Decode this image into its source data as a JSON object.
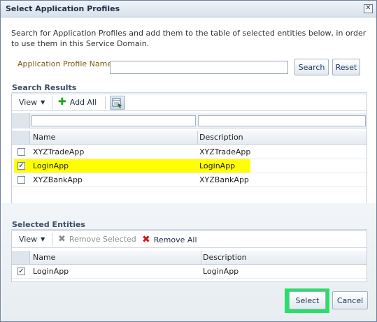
{
  "dialog": {
    "title": "Select Application Profiles",
    "close_glyph": "✕",
    "instructions": "Search for Application Profiles and add them to the table of selected entities below, in order to use them in this Service Domain.",
    "name_label": "Application Profile Name",
    "name_value": "",
    "search_label": "Search",
    "reset_label": "Reset"
  },
  "search_results": {
    "title": "Search Results",
    "toolbar": {
      "view_label": "View",
      "add_all_label": "Add All",
      "columns_icon": "columns-icon"
    },
    "columns": {
      "name": "Name",
      "description": "Description"
    },
    "rows": [
      {
        "name": "XYZTradeApp",
        "description": "XYZTradeApp",
        "checked": false
      },
      {
        "name": "LoginApp",
        "description": "LoginApp",
        "checked": true
      },
      {
        "name": "XYZBankApp",
        "description": "XYZBankApp",
        "checked": false
      }
    ]
  },
  "selected_entities": {
    "title": "Selected Entities",
    "toolbar": {
      "view_label": "View",
      "remove_selected_label": "Remove Selected",
      "remove_all_label": "Remove All"
    },
    "columns": {
      "name": "Name",
      "description": "Description"
    },
    "rows": [
      {
        "name": "LoginApp",
        "description": "LoginApp",
        "checked": true
      }
    ]
  },
  "footer": {
    "select_label": "Select",
    "cancel_label": "Cancel"
  },
  "colors": {
    "highlight": "#ffff00",
    "focus_ring": "#27e06a",
    "accent": "#1b3a62"
  }
}
